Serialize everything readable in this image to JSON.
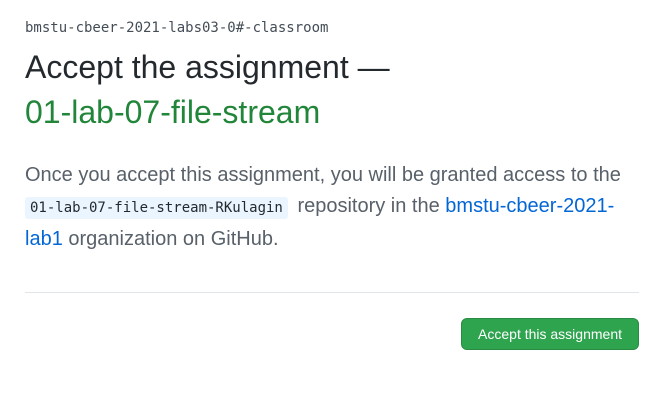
{
  "header": {
    "org_name": "bmstu-cbeer-2021-labs03-0#-classroom",
    "title_line1": "Accept the assignment —",
    "title_line2": "01-lab-07-file-stream"
  },
  "description": {
    "text_before": "Once you accept this assignment, you will be granted access to the",
    "repo_name": "01-lab-07-file-stream-RKulagin",
    "text_middle": "repository in the",
    "org_link": "bmstu-cbeer-2021-lab1",
    "text_after": "organization on GitHub."
  },
  "actions": {
    "accept_label": "Accept this assignment"
  },
  "colors": {
    "title_green": "#22863a",
    "link_blue": "#0366d6",
    "button_green": "#2ea44f",
    "code_bg": "#eaf5ff"
  }
}
